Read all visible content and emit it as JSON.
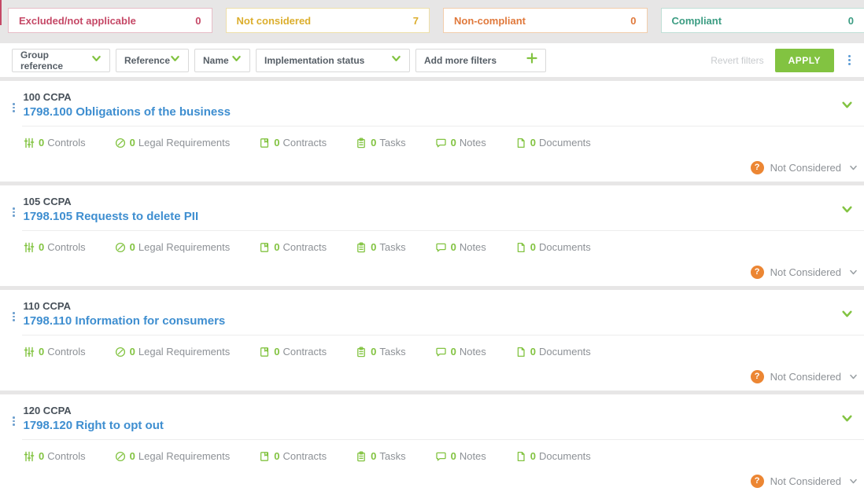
{
  "colors": {
    "accent_green": "#82c341",
    "link_blue": "#3e8ed0",
    "badge_orange": "#ec8633",
    "excluded_red": "#c54866",
    "not_considered_gold": "#dcae2d",
    "non_compliant_orange": "#e0793c",
    "compliant_teal": "#3b9c82"
  },
  "summary_cards": [
    {
      "label": "Excluded/not applicable",
      "count": "0"
    },
    {
      "label": "Not considered",
      "count": "7"
    },
    {
      "label": "Non-compliant",
      "count": "0"
    },
    {
      "label": "Compliant",
      "count": "0"
    }
  ],
  "filters": {
    "dropdowns": [
      {
        "label": "Group reference"
      },
      {
        "label": "Reference"
      },
      {
        "label": "Name"
      },
      {
        "label": "Implementation status"
      }
    ],
    "add_more_label": "Add more filters",
    "revert_label": "Revert filters",
    "apply_label": "APPLY"
  },
  "items": [
    {
      "group": "100 CCPA",
      "title": "1798.100 Obligations of the business",
      "status": "Not Considered",
      "stats": [
        {
          "count": "0",
          "label": "Controls"
        },
        {
          "count": "0",
          "label": "Legal Requirements"
        },
        {
          "count": "0",
          "label": "Contracts"
        },
        {
          "count": "0",
          "label": "Tasks"
        },
        {
          "count": "0",
          "label": "Notes"
        },
        {
          "count": "0",
          "label": "Documents"
        }
      ]
    },
    {
      "group": "105 CCPA",
      "title": "1798.105 Requests to delete PII",
      "status": "Not Considered",
      "stats": [
        {
          "count": "0",
          "label": "Controls"
        },
        {
          "count": "0",
          "label": "Legal Requirements"
        },
        {
          "count": "0",
          "label": "Contracts"
        },
        {
          "count": "0",
          "label": "Tasks"
        },
        {
          "count": "0",
          "label": "Notes"
        },
        {
          "count": "0",
          "label": "Documents"
        }
      ]
    },
    {
      "group": "110 CCPA",
      "title": "1798.110 Information for consumers",
      "status": "Not Considered",
      "stats": [
        {
          "count": "0",
          "label": "Controls"
        },
        {
          "count": "0",
          "label": "Legal Requirements"
        },
        {
          "count": "0",
          "label": "Contracts"
        },
        {
          "count": "0",
          "label": "Tasks"
        },
        {
          "count": "0",
          "label": "Notes"
        },
        {
          "count": "0",
          "label": "Documents"
        }
      ]
    },
    {
      "group": "120 CCPA",
      "title": "1798.120 Right to opt out",
      "status": "Not Considered",
      "stats": [
        {
          "count": "0",
          "label": "Controls"
        },
        {
          "count": "0",
          "label": "Legal Requirements"
        },
        {
          "count": "0",
          "label": "Contracts"
        },
        {
          "count": "0",
          "label": "Tasks"
        },
        {
          "count": "0",
          "label": "Notes"
        },
        {
          "count": "0",
          "label": "Documents"
        }
      ]
    }
  ]
}
